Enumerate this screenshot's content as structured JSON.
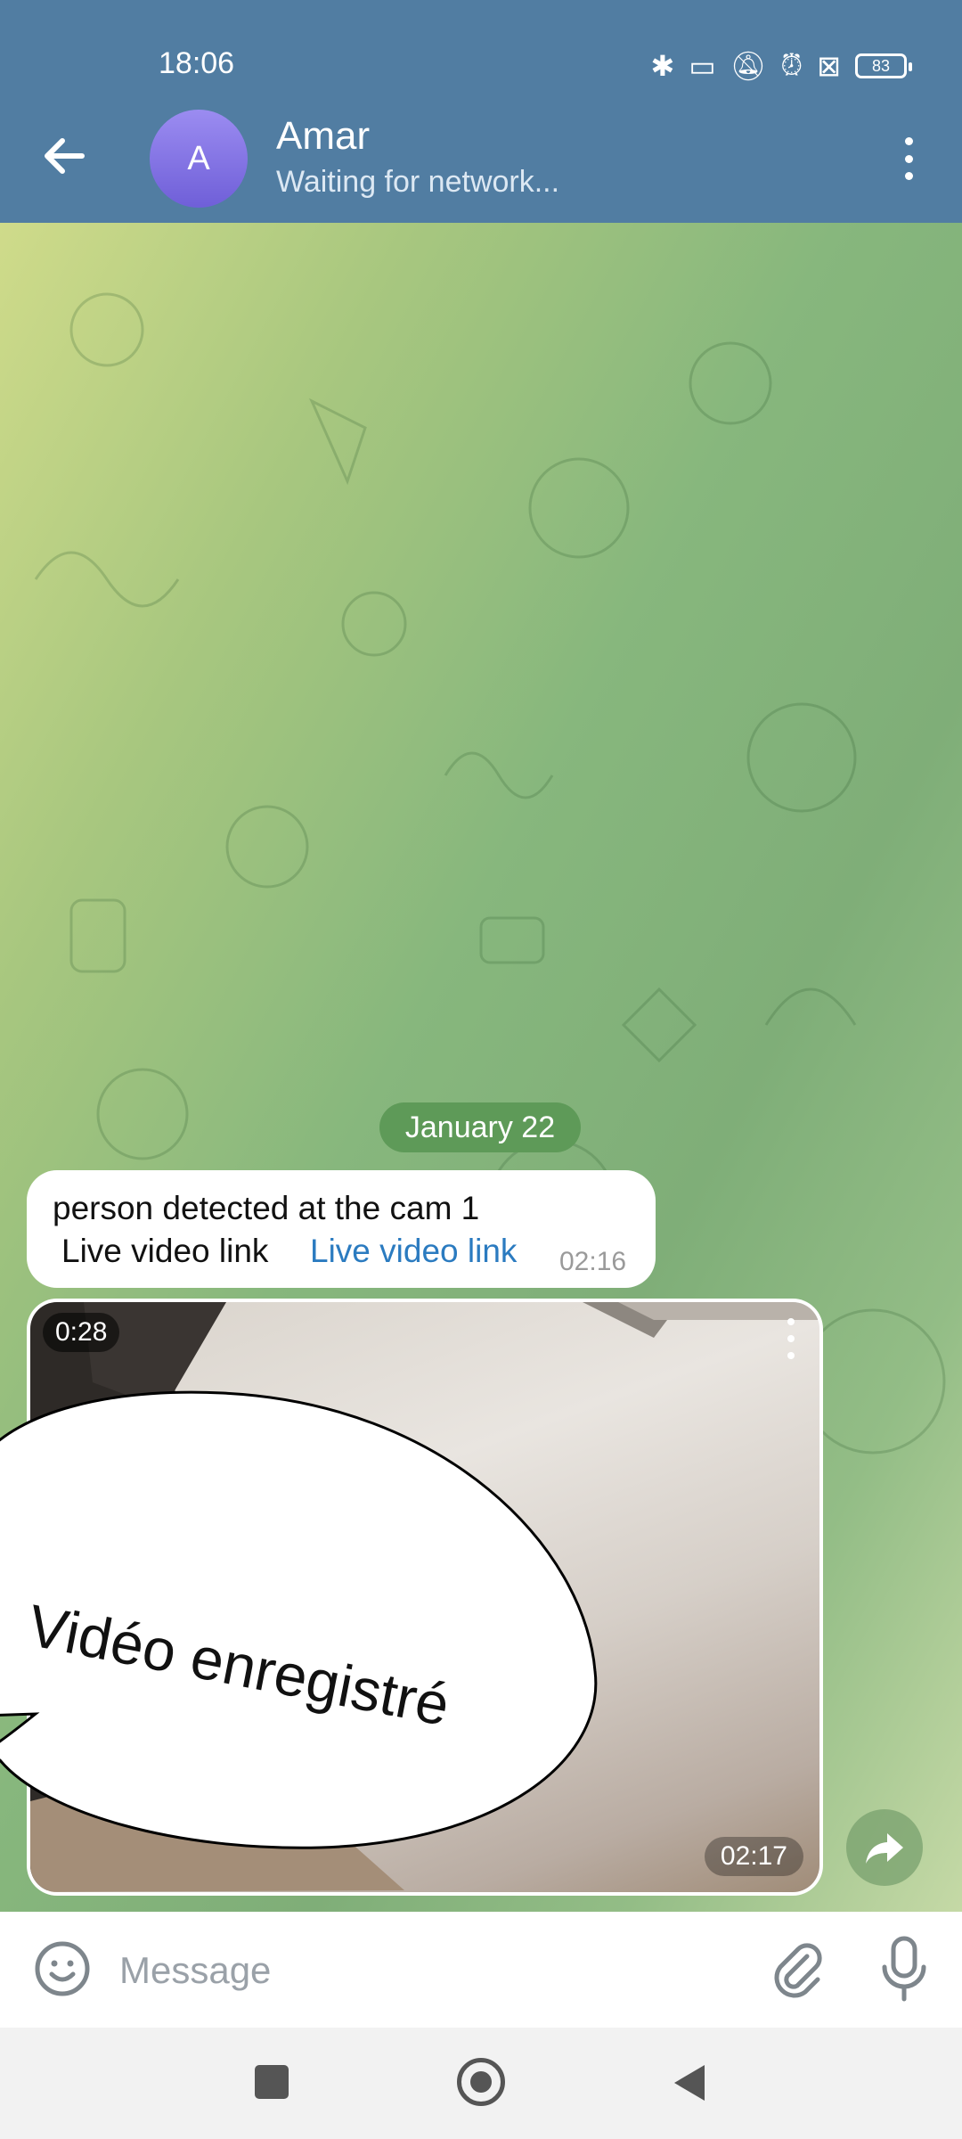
{
  "status_bar": {
    "time": "18:06",
    "battery": "83"
  },
  "header": {
    "avatar_letter": "A",
    "title": "Amar",
    "subtitle": "Waiting for network..."
  },
  "chat": {
    "date_label": "January 22",
    "message": {
      "line1": "person detected at the cam 1",
      "line2": "Live video link",
      "link": "Live video link",
      "time": "02:16"
    },
    "video": {
      "duration": "0:28",
      "time": "02:17"
    }
  },
  "overlay": {
    "speech_text": "Vidéo enregistré"
  },
  "input": {
    "placeholder": "Message"
  },
  "colors": {
    "header": "#517da2",
    "link": "#2b7bc0",
    "date_pill": "#5e9a58"
  }
}
